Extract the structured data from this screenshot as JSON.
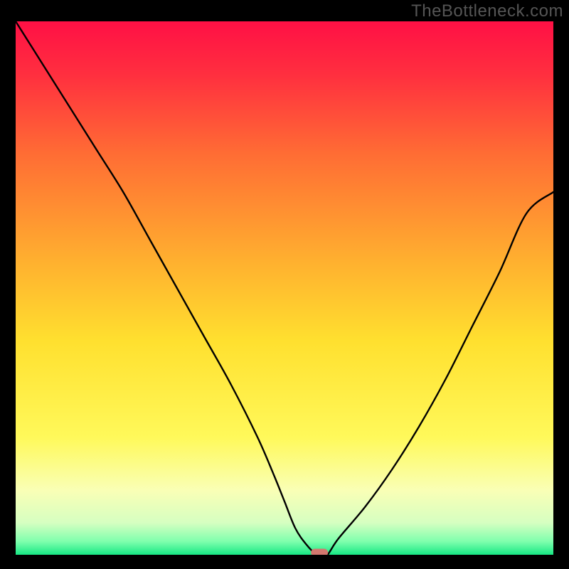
{
  "watermark": "TheBottleneck.com",
  "chart_data": {
    "type": "line",
    "title": "",
    "xlabel": "",
    "ylabel": "",
    "xlim": [
      0,
      100
    ],
    "ylim": [
      0,
      100
    ],
    "grid": false,
    "legend": false,
    "series": [
      {
        "name": "bottleneck-curve",
        "x": [
          0,
          5,
          10,
          15,
          20,
          25,
          30,
          35,
          40,
          45,
          48,
          50,
          52,
          54,
          56,
          57,
          58,
          60,
          65,
          70,
          75,
          80,
          85,
          90,
          95,
          100
        ],
        "y": [
          100,
          92,
          84,
          76,
          68,
          59,
          50,
          41,
          32,
          22,
          15,
          10,
          5,
          2,
          0,
          0,
          0,
          3,
          9,
          16,
          24,
          33,
          43,
          53,
          64,
          68
        ]
      }
    ],
    "marker": {
      "x": 56.5,
      "y": 0,
      "color": "#d3786f"
    },
    "background_gradient": {
      "stops": [
        {
          "offset": 0.0,
          "color": "#ff1045"
        },
        {
          "offset": 0.1,
          "color": "#ff2f3f"
        },
        {
          "offset": 0.25,
          "color": "#ff6d34"
        },
        {
          "offset": 0.45,
          "color": "#ffb02f"
        },
        {
          "offset": 0.6,
          "color": "#ffe02f"
        },
        {
          "offset": 0.78,
          "color": "#fff95a"
        },
        {
          "offset": 0.88,
          "color": "#f9ffb6"
        },
        {
          "offset": 0.94,
          "color": "#d6ffc1"
        },
        {
          "offset": 0.975,
          "color": "#7fffad"
        },
        {
          "offset": 1.0,
          "color": "#17e884"
        }
      ]
    }
  }
}
